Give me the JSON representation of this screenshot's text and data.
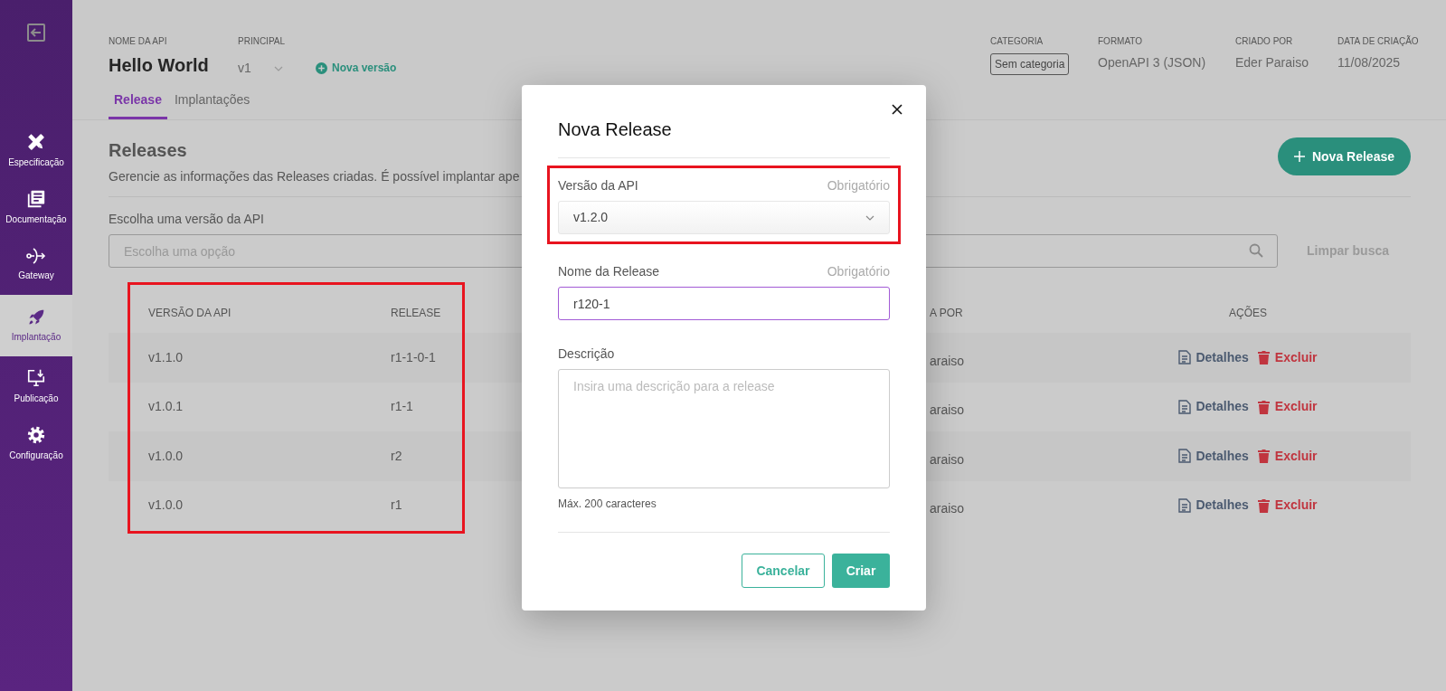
{
  "sidebar": {
    "items": [
      {
        "label": "Especificação",
        "selected": false
      },
      {
        "label": "Documentação",
        "selected": false
      },
      {
        "label": "Gateway",
        "selected": false
      },
      {
        "label": "Implantação",
        "selected": true
      },
      {
        "label": "Publicação",
        "selected": false
      },
      {
        "label": "Configuração",
        "selected": false
      }
    ]
  },
  "header": {
    "api_name_label": "NOME DA API",
    "api_name": "Hello World",
    "principal_label": "PRINCIPAL",
    "principal_value": "v1",
    "new_version": "Nova versão",
    "meta": [
      {
        "label": "CATEGORIA",
        "value": "Sem categoria",
        "kind": "badge"
      },
      {
        "label": "FORMATO",
        "value": "OpenAPI 3 (JSON)",
        "kind": "text"
      },
      {
        "label": "CRIADO POR",
        "value": "Eder Paraiso",
        "kind": "text"
      },
      {
        "label": "DATA DE CRIAÇÃO",
        "value": "11/08/2025",
        "kind": "text"
      }
    ]
  },
  "tabs": [
    {
      "label": "Release",
      "selected": true
    },
    {
      "label": "Implantações",
      "selected": false
    }
  ],
  "releases": {
    "title": "Releases",
    "description": "Gerencie as informações das Releases criadas. É possível implantar ape",
    "new_button": "Nova Release",
    "filter_label": "Escolha uma versão da API",
    "filter_placeholder": "Escolha uma opção",
    "clear_button": "Limpar busca"
  },
  "table": {
    "highlight": true,
    "columns": [
      "VERSÃO DA API",
      "RELEASE",
      "A POR",
      "AÇÕES"
    ],
    "rows": [
      {
        "cells": [
          "v1.1.0",
          "r1-1-0-1",
          "araiso"
        ],
        "actions": [
          "Detalhes",
          "Excluir"
        ]
      },
      {
        "cells": [
          "v1.0.1",
          "r1-1",
          "araiso"
        ],
        "actions": [
          "Detalhes",
          "Excluir"
        ]
      },
      {
        "cells": [
          "v1.0.0",
          "r2",
          "araiso"
        ],
        "actions": [
          "Detalhes",
          "Excluir"
        ]
      },
      {
        "cells": [
          "v1.0.0",
          "r1",
          "araiso"
        ],
        "actions": [
          "Detalhes",
          "Excluir"
        ]
      }
    ]
  },
  "modal": {
    "title": "Nova Release",
    "version": {
      "label": "Versão da API",
      "required": "Obrigatório",
      "value": "v1.2.0",
      "highlight": true
    },
    "name": {
      "label": "Nome da Release",
      "required": "Obrigatório",
      "value": "r120-1",
      "focused": true
    },
    "description": {
      "label": "Descrição",
      "placeholder": "Insira uma descrição para a release",
      "hint": "Máx. 200 caracteres"
    },
    "cancel": "Cancelar",
    "submit": "Criar"
  }
}
